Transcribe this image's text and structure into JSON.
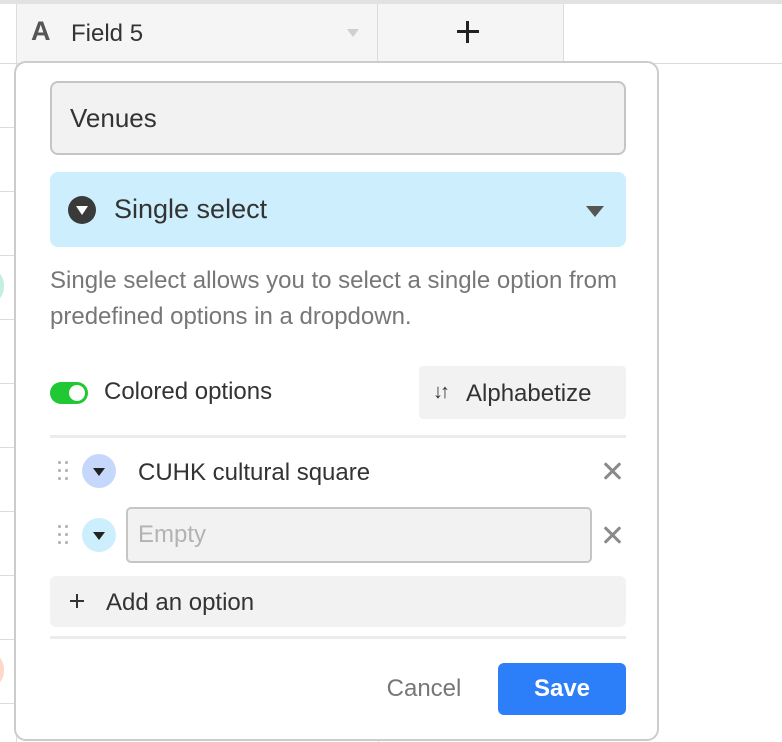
{
  "grid": {
    "field_header": {
      "type_icon": "A",
      "name": "Field 5",
      "menu_icon": "chevron-down-icon"
    },
    "add_field_icon": "plus-icon"
  },
  "dialog": {
    "field_name_value": "Venues",
    "field_type": {
      "label": "Single select",
      "icon": "single-select-icon"
    },
    "description": "Single select allows you to select a single option from predefined options in a dropdown.",
    "colored_options": {
      "label": "Colored options",
      "enabled": true,
      "color": "#20c933"
    },
    "alphabetize": {
      "label": "Alphabetize",
      "icon": "sort-icon",
      "icon_glyph": "↓↑"
    },
    "options": [
      {
        "label": "CUHK cultural square",
        "color": "#c5d8fc"
      },
      {
        "label": "",
        "placeholder": "Empty",
        "color": "#cdeefc"
      }
    ],
    "add_option_label": "Add an option",
    "cancel_label": "Cancel",
    "save_label": "Save"
  },
  "colors": {
    "accent": "#2d7ff9",
    "type_selector_bg": "#cdeefc"
  }
}
